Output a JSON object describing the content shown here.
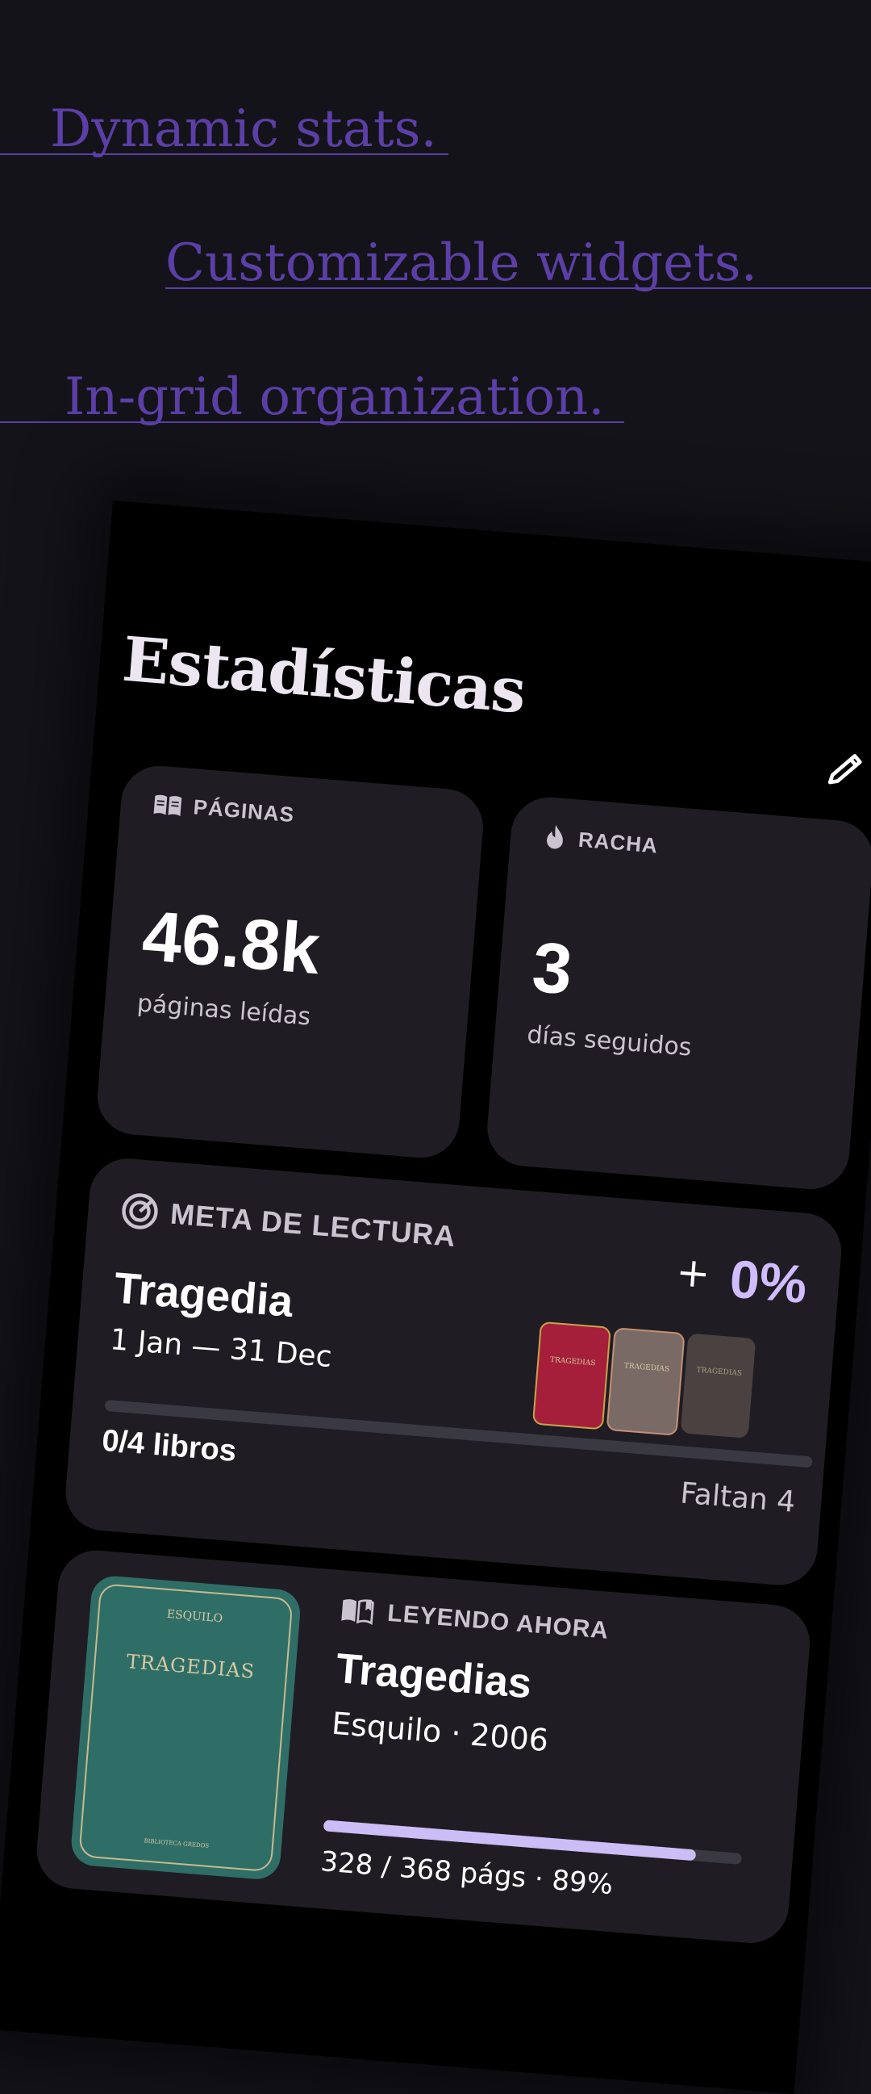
{
  "taglines": [
    "Dynamic stats.",
    "Customizable widgets.",
    "In-grid organization."
  ],
  "screen": {
    "title": "Estadísticas",
    "pages_card": {
      "label": "PÁGINAS",
      "value": "46.8k",
      "caption": "páginas leídas"
    },
    "streak_card": {
      "label": "RACHA",
      "value": "3",
      "caption": "días seguidos"
    },
    "goal_card": {
      "label": "META DE LECTURA",
      "plus": "+",
      "percent": "0%",
      "name": "Tragedia",
      "range": "1 Jan — 31 Dec",
      "count": "0/4 libros",
      "remaining": "Faltan 4",
      "progress": 0,
      "mini_covers": [
        {
          "title": "TRAGEDIAS",
          "color": "#a51f3a"
        },
        {
          "title": "TRAGEDIAS",
          "color": "#7a6a66"
        },
        {
          "title": "TRAGEDIAS",
          "color": "#5a4e4b"
        }
      ]
    },
    "reading_card": {
      "label": "LEYENDO AHORA",
      "title": "Tragedias",
      "meta": "Esquilo · 2006",
      "progress_text": "328 / 368 págs · 89%",
      "progress": 0.89,
      "cover": {
        "author": "ESQUILO",
        "title": "TRAGEDIAS",
        "publisher": "BIBLIOTECA GREDOS",
        "color": "#2f6e67"
      }
    }
  },
  "colors": {
    "accent": "#5b3fa6",
    "progress": "#cbbdf6",
    "card": "#1f1d23",
    "percent": "#d0bcff"
  }
}
